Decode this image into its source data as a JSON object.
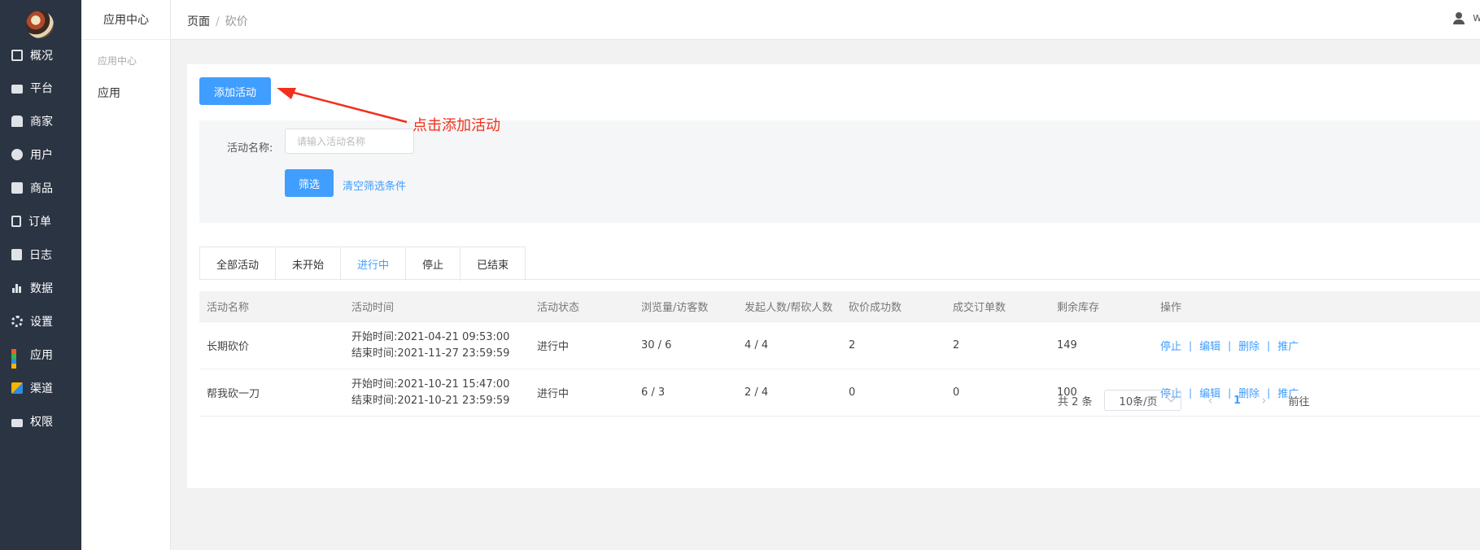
{
  "nav": {
    "items": [
      {
        "label": "概况",
        "icon": "dashboard-icon"
      },
      {
        "label": "平台",
        "icon": "monitor-icon"
      },
      {
        "label": "商家",
        "icon": "store-icon"
      },
      {
        "label": "用户",
        "icon": "user-icon"
      },
      {
        "label": "商品",
        "icon": "bag-icon"
      },
      {
        "label": "订单",
        "icon": "clipboard-icon"
      },
      {
        "label": "日志",
        "icon": "book-icon"
      },
      {
        "label": "数据",
        "icon": "bar-chart-icon"
      },
      {
        "label": "设置",
        "icon": "gear-icon"
      },
      {
        "label": "应用",
        "icon": "apps-icon"
      },
      {
        "label": "渠道",
        "icon": "cube-icon"
      },
      {
        "label": "权限",
        "icon": "lock-icon"
      }
    ],
    "app_colors": [
      "#f15a24",
      "#39b54a",
      "#2e8ce6",
      "#f7b500"
    ]
  },
  "subnav": {
    "title": "应用中心",
    "group": "应用中心",
    "item": "应用"
  },
  "topbar": {
    "crumb_home": "页面",
    "crumb_sep": "/",
    "crumb_current": "砍价",
    "user": "w"
  },
  "actions": {
    "add_label": "添加活动",
    "annotation": "点击添加活动",
    "annotation_color": "#f1301d"
  },
  "filter": {
    "name_label": "活动名称:",
    "name_placeholder": "请输入活动名称",
    "name_value": "",
    "submit_label": "筛选",
    "clear_label": "清空筛选条件"
  },
  "tabs": [
    "全部活动",
    "未开始",
    "进行中",
    "停止",
    "已结束"
  ],
  "active_tab": "进行中",
  "table": {
    "columns": [
      "活动名称",
      "活动时间",
      "活动状态",
      "浏览量/访客数",
      "发起人数/帮砍人数",
      "砍价成功数",
      "成交订单数",
      "剩余库存",
      "操作"
    ],
    "rows": [
      {
        "name": "长期砍价",
        "start": "开始时间:2021-04-21 09:53:00",
        "end": "结束时间:2021-11-27 23:59:59",
        "status": "进行中",
        "views": "30 / 6",
        "people": "4 / 4",
        "success": "2",
        "orders": "2",
        "stock": "149"
      },
      {
        "name": "帮我砍一刀",
        "start": "开始时间:2021-10-21 15:47:00",
        "end": "结束时间:2021-10-21 23:59:59",
        "status": "进行中",
        "views": "6 / 3",
        "people": "2 / 4",
        "success": "0",
        "orders": "0",
        "stock": "100"
      }
    ],
    "ops": [
      "停止",
      "编辑",
      "删除",
      "推广"
    ],
    "op_sep": "|"
  },
  "pager": {
    "total": "共 2 条",
    "page_size": "10条/页",
    "prev": "‹",
    "page": "1",
    "next": "›",
    "goto": "前往"
  },
  "colors": {
    "accent": "#409eff",
    "nav_bg": "#2b3442"
  }
}
